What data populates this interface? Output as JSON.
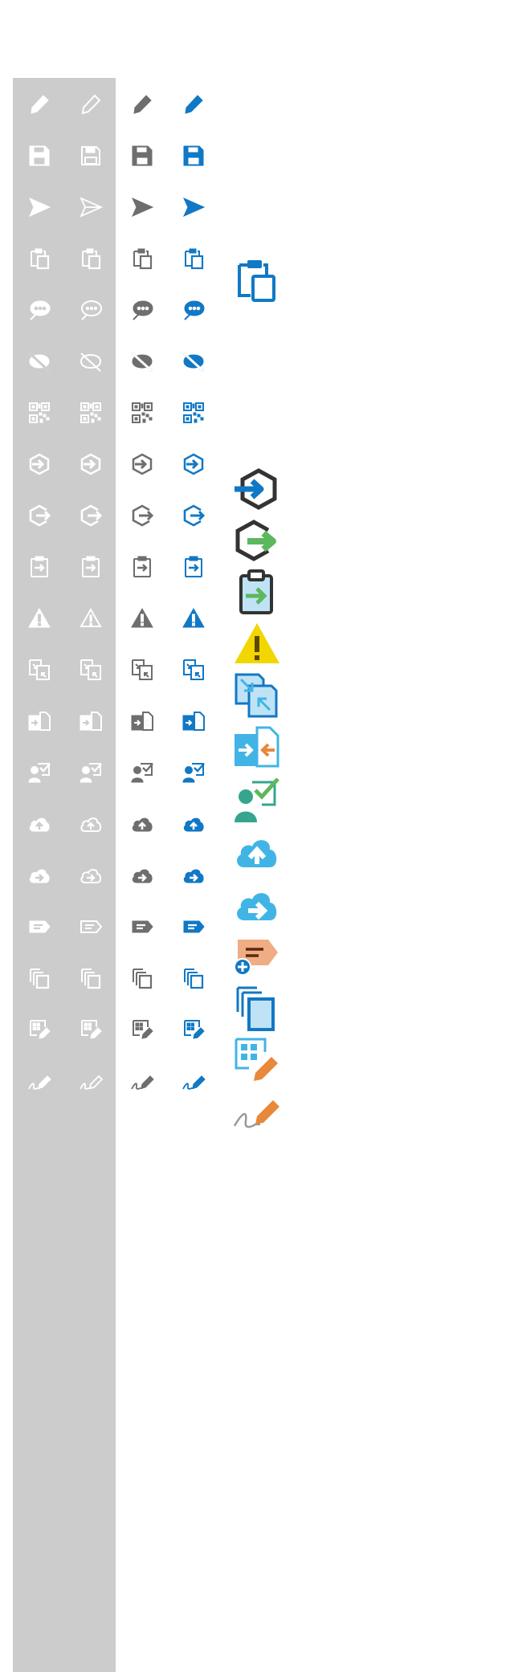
{
  "palette": {
    "panel": "#cccccc",
    "white": "#ffffff",
    "gray": "#6e6e6e",
    "blue": "#1178c5",
    "light_blue": "#41b4e6",
    "pale_blue": "#bfe3f5",
    "green": "#5cb85c",
    "teal": "#36a58d",
    "yellow": "#f2d600",
    "orange": "#e8883a",
    "peach": "#f0ad84",
    "dark": "#333333"
  },
  "columns": [
    "white-solid",
    "white-outline",
    "gray",
    "blue",
    "color-large"
  ],
  "rows": [
    {
      "icon": "pencil-icon",
      "large": false
    },
    {
      "icon": "save-icon",
      "large": false
    },
    {
      "icon": "send-icon",
      "large": false
    },
    {
      "icon": "clipboard-icon",
      "large": true
    },
    {
      "icon": "chat-bubble-icon",
      "large": false
    },
    {
      "icon": "hide-comment-icon",
      "large": false
    },
    {
      "icon": "qr-code-icon",
      "large": false
    },
    {
      "icon": "hex-arrow-in-icon",
      "large": true
    },
    {
      "icon": "hex-arrow-out-icon",
      "large": true
    },
    {
      "icon": "clipboard-arrow-icon",
      "large": true
    },
    {
      "icon": "warning-icon",
      "large": true
    },
    {
      "icon": "compare-documents-icon",
      "large": true
    },
    {
      "icon": "merge-documents-icon",
      "large": true
    },
    {
      "icon": "user-approve-icon",
      "large": true
    },
    {
      "icon": "cloud-upload-icon",
      "large": true
    },
    {
      "icon": "cloud-forward-icon",
      "large": true
    },
    {
      "icon": "tag-add-icon",
      "large": true
    },
    {
      "icon": "copy-pages-icon",
      "large": true
    },
    {
      "icon": "grid-edit-icon",
      "large": true
    },
    {
      "icon": "signature-icon",
      "large": true
    }
  ]
}
